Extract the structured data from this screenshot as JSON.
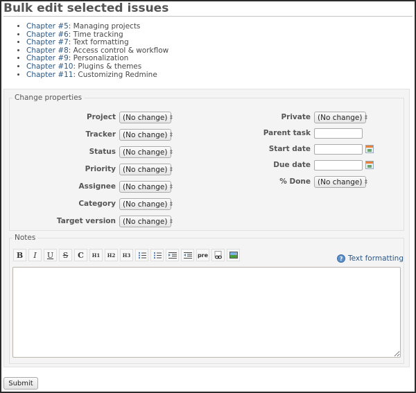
{
  "page": {
    "title": "Bulk edit selected issues"
  },
  "issues": [
    {
      "link": "Chapter #5",
      "title": ": Managing projects"
    },
    {
      "link": "Chapter #6",
      "title": ": Time tracking"
    },
    {
      "link": "Chapter #7",
      "title": ": Text formatting"
    },
    {
      "link": "Chapter #8",
      "title": ": Access control & workflow"
    },
    {
      "link": "Chapter #9",
      "title": ": Personalization"
    },
    {
      "link": "Chapter #10",
      "title": ": Plugins & themes"
    },
    {
      "link": "Chapter #11",
      "title": ": Customizing Redmine"
    }
  ],
  "properties": {
    "legend": "Change properties",
    "left": [
      {
        "label": "Project",
        "value": "(No change)"
      },
      {
        "label": "Tracker",
        "value": "(No change)"
      },
      {
        "label": "Status",
        "value": "(No change)"
      },
      {
        "label": "Priority",
        "value": "(No change)"
      },
      {
        "label": "Assignee",
        "value": "(No change)"
      },
      {
        "label": "Category",
        "value": "(No change)"
      },
      {
        "label": "Target version",
        "value": "(No change)"
      }
    ],
    "right": {
      "private": {
        "label": "Private",
        "value": "(No change)"
      },
      "parent_task": {
        "label": "Parent task",
        "value": ""
      },
      "start_date": {
        "label": "Start date",
        "value": ""
      },
      "due_date": {
        "label": "Due date",
        "value": ""
      },
      "done": {
        "label": "% Done",
        "value": "(No change)"
      }
    }
  },
  "notes": {
    "legend": "Notes",
    "value": "",
    "help_link": "Text formatting",
    "toolbar": [
      {
        "name": "bold",
        "glyph": "B"
      },
      {
        "name": "italic",
        "glyph": "I"
      },
      {
        "name": "underline",
        "glyph": "U"
      },
      {
        "name": "strikethrough",
        "glyph": "S"
      },
      {
        "name": "code",
        "glyph": "C"
      },
      {
        "name": "heading-1",
        "glyph": "H1"
      },
      {
        "name": "heading-2",
        "glyph": "H2"
      },
      {
        "name": "heading-3",
        "glyph": "H3"
      },
      {
        "name": "unordered-list",
        "glyph": ""
      },
      {
        "name": "ordered-list",
        "glyph": ""
      },
      {
        "name": "quote",
        "glyph": ""
      },
      {
        "name": "unquote",
        "glyph": ""
      },
      {
        "name": "preformatted",
        "glyph": "pre"
      },
      {
        "name": "wiki-link",
        "glyph": ""
      },
      {
        "name": "image",
        "glyph": ""
      }
    ]
  },
  "actions": {
    "submit": "Submit"
  },
  "colors": {
    "link": "#2a5685",
    "panel_bg": "#f4f4f4"
  }
}
